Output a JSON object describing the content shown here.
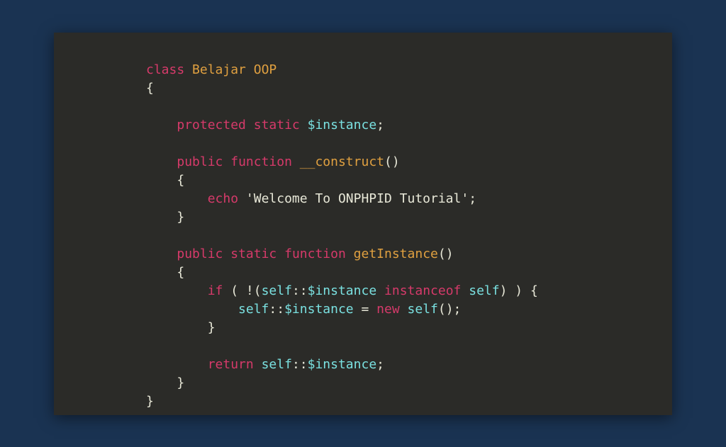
{
  "code": {
    "line1": {
      "kw_class": "class",
      "class_name": "Belajar OOP"
    },
    "line2": {
      "open_brace": "{"
    },
    "line3": "",
    "line4": {
      "protected": "protected",
      "static": "static",
      "var": "$instance",
      "semi": ";"
    },
    "line5": "",
    "line6": {
      "public": "public",
      "function": "function",
      "name": "__construct",
      "parens": "()"
    },
    "line7": {
      "open_brace": "{"
    },
    "line8": {
      "echo": "echo",
      "string": "'Welcome To ONPHPID Tutorial'",
      "semi": ";"
    },
    "line9": {
      "close_brace": "}"
    },
    "line10": "",
    "line11": {
      "public": "public",
      "static": "static",
      "function": "function",
      "name": "getInstance",
      "parens": "()"
    },
    "line12": {
      "open_brace": "{"
    },
    "line13": {
      "if": "if",
      "open": " ( !(",
      "self1": "self",
      "scope1": "::",
      "var1": "$instance",
      "instanceof": "instanceof",
      "self2": "self",
      "close": ") ) {"
    },
    "line14": {
      "self": "self",
      "scope": "::",
      "var": "$instance",
      "eq": " = ",
      "new": "new",
      "self2": "self",
      "tail": "();"
    },
    "line15": {
      "close_brace": "}"
    },
    "line16": "",
    "line17": {
      "return": "return",
      "self": "self",
      "scope": "::",
      "var": "$instance",
      "semi": ";"
    },
    "line18": {
      "close_brace": "}"
    },
    "line19": {
      "close_brace": "}"
    }
  }
}
